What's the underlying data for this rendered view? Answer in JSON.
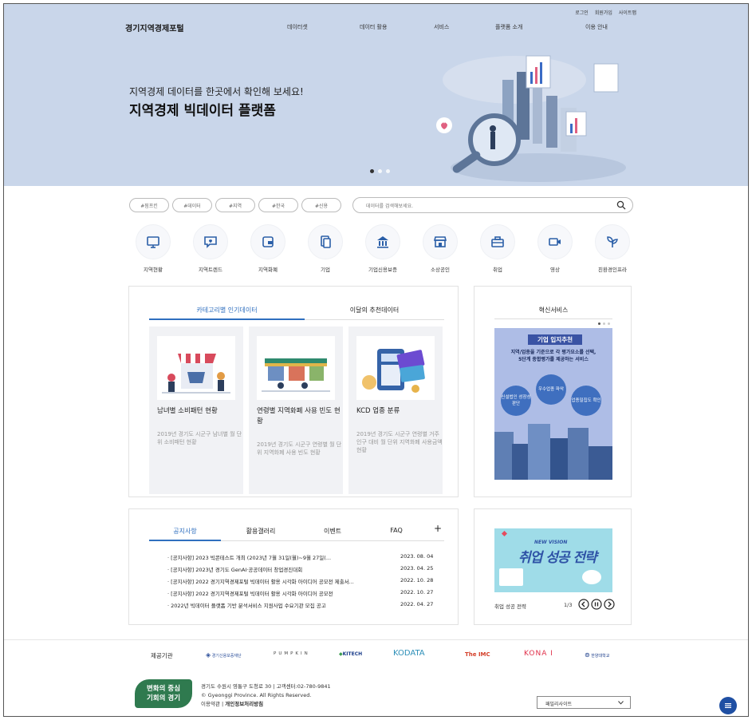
{
  "util": {
    "login": "로그인",
    "join": "회원가입",
    "sitemap": "사이트맵"
  },
  "logo": "경기지역경제포털",
  "gnb": [
    "데이터셋",
    "데이터 활용",
    "서비스",
    "플랫폼 소개",
    "이용 안내"
  ],
  "hero": {
    "subtitle": "지역경제 데이터를 한곳에서 확인해 보세요!",
    "title": "지역경제 빅데이터 플랫폼"
  },
  "tags": [
    "#핌프킨",
    "#데이터",
    "#지역",
    "#한국",
    "#신용"
  ],
  "search": {
    "placeholder": "데이터를 검색해보세요."
  },
  "categories": [
    "지역현황",
    "지역트렌드",
    "지역화폐",
    "기업",
    "기업신용보증",
    "소상공인",
    "취업",
    "영상",
    "친환경인프라"
  ],
  "popular": {
    "tabs": [
      "카테고리별 인기데이터",
      "이달의 추천데이터"
    ],
    "cards": [
      {
        "title": "남녀별 소비패턴 현황",
        "desc": "2019년 경기도 시군구 남녀별 월 단위 소비패턴 현황"
      },
      {
        "title": "연령별 지역화폐 사용 빈도 현황",
        "desc": "2019년 경기도 시군구 연령별 월 단위 지역화폐 사용 빈도 현황"
      },
      {
        "title": "KCD 업종 분류",
        "desc": "2019년 경기도 시군구 연령별 거주인구 대비 월 단위 지역화폐 사용금액 현황"
      }
    ]
  },
  "innovation": {
    "title": "혁신서비스",
    "banner_title": "기업 입지추천",
    "banner_desc1": "지역/업종을 기준으로 각 평가요소를 선택,",
    "banner_desc2": "5단계 종합평가를 제공하는 서비스",
    "bubbles": [
      "신설법인 성장성 판단",
      "우수업종 파악",
      "업종밀집도 확인"
    ]
  },
  "board": {
    "tabs": [
      "공지사항",
      "활용갤러리",
      "이벤트",
      "FAQ"
    ],
    "more": "+",
    "notices": [
      {
        "text": "[공지사항] 2023 빅콘테스트 개최 (2023년 7월 31일(월)~9월 27일(...",
        "date": "2023. 08. 04"
      },
      {
        "text": "[공지사항] 2023년 경기도 GenAI·공공데이터 창업경진대회",
        "date": "2023. 04. 25"
      },
      {
        "text": "[공지사항] 2022 경기지역경제포털 빅데이터 활용 시각화 아이디어 공모전 제출서...",
        "date": "2022. 10. 28"
      },
      {
        "text": "[공지사항] 2022 경기지역경제포털 빅데이터 활용 시각화 아이디어 공모전",
        "date": "2022. 10. 27"
      },
      {
        "text": "2022년 빅데이터 플랫폼 기반 분석서비스 지원사업 수요기관 모집 공고",
        "date": "2022. 04. 27"
      }
    ]
  },
  "video": {
    "banner_text": "취업 성공 전략",
    "banner_en": "NEW VISION",
    "caption": "취업 성공 전략",
    "page": "1/3"
  },
  "partners": {
    "label": "제공기관",
    "logos": [
      "경기신용보증재단",
      "PUMPKIN",
      "KITECH",
      "KODATA",
      "The IMC",
      "KONA I",
      "한양대학교"
    ]
  },
  "footer": {
    "badge1": "변화의 중심",
    "badge2": "기회의 경기",
    "address": "경기도 수원시 영통구 도청로 30 | 고객센터:02-780-9841",
    "copyright": "© Gyeonggi Province. All Rights Reserved.",
    "terms": "이용약관",
    "privacy": "개인정보처리방침",
    "family_site": "패밀리사이트"
  },
  "colors": {
    "hero_bg": "#c9d6ea",
    "accent": "#2f6fbf",
    "fab": "#1f4fa3",
    "footer_badge": "#2f7a4f"
  }
}
